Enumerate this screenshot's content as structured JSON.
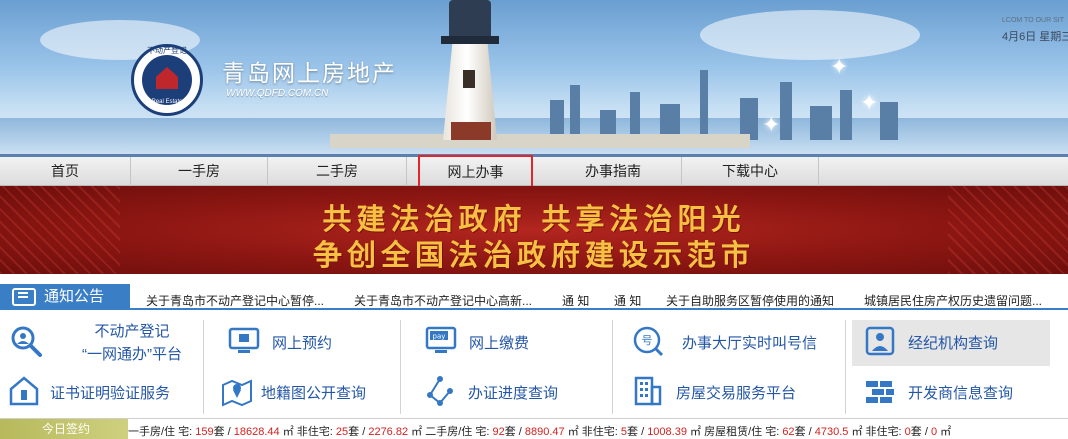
{
  "header": {
    "site_title": "青岛网上房地产",
    "site_url": "WWW.QDFD.COM.CN",
    "logo_text_top": "不动产登记",
    "logo_text_bottom": "Real Estate Registration",
    "welcome": "LCOM TO OUR SIT",
    "date": "4月6日 星期三"
  },
  "nav": {
    "items": [
      {
        "label": "首页"
      },
      {
        "label": "一手房"
      },
      {
        "label": "二手房"
      },
      {
        "label": "网上办事"
      },
      {
        "label": "办事指南"
      },
      {
        "label": "下载中心"
      }
    ],
    "highlighted": "网上办事",
    "highlight_color": "#e3262b"
  },
  "banner": {
    "line1": "共建法治政府  共享法治阳光",
    "line2": "争创全国法治政府建设示范市"
  },
  "notice": {
    "label": "通知公告",
    "items": [
      "关于青岛市不动产登记中心暂停...",
      "关于青岛市不动产登记中心高新...",
      "通 知",
      "通 知",
      "关于自助服务区暂停使用的通知",
      "城镇居民住房产权历史遗留问题..."
    ]
  },
  "services": {
    "row1": [
      {
        "label_line1": "不动产登记",
        "label_line2": "“一网通办”平台",
        "icon": "search-person-icon"
      },
      {
        "label": "网上预约",
        "icon": "computer-icon"
      },
      {
        "label": "网上缴费",
        "icon": "pay-icon"
      },
      {
        "label": "办事大厅实时叫号信",
        "icon": "queue-number-icon"
      },
      {
        "label": "经纪机构查询",
        "icon": "agent-icon"
      }
    ],
    "row2": [
      {
        "label": "证书证明验证服务",
        "icon": "house-id-icon"
      },
      {
        "label": "地籍图公开查询",
        "icon": "map-pin-icon"
      },
      {
        "label": "办证进度查询",
        "icon": "progress-icon"
      },
      {
        "label": "房屋交易服务平台",
        "icon": "building-icon"
      },
      {
        "label": "开发商信息查询",
        "icon": "bricks-icon"
      }
    ]
  },
  "stats": {
    "badge": "今日签约",
    "first_hand_label": "一手房/住 宅:",
    "first_hand_res_units": "159",
    "first_hand_res_area": "18628.44",
    "first_hand_nonres_units": "25",
    "first_hand_nonres_area": "2276.82",
    "second_hand_label": "二手房/住 宅:",
    "second_hand_res_units": "92",
    "second_hand_res_area": "8890.47",
    "second_hand_nonres_units": "5",
    "second_hand_nonres_area": "1008.39",
    "rental_label": "房屋租赁/住 宅:",
    "rental_res_units": "62",
    "rental_res_area": "4730.5",
    "rental_nonres_units": "0",
    "rental_nonres_area": "0",
    "unit_tao": "套",
    "unit_sqm": "㎡",
    "nonres_label": "非住宅:",
    "highlight_color": "#d3221f"
  }
}
